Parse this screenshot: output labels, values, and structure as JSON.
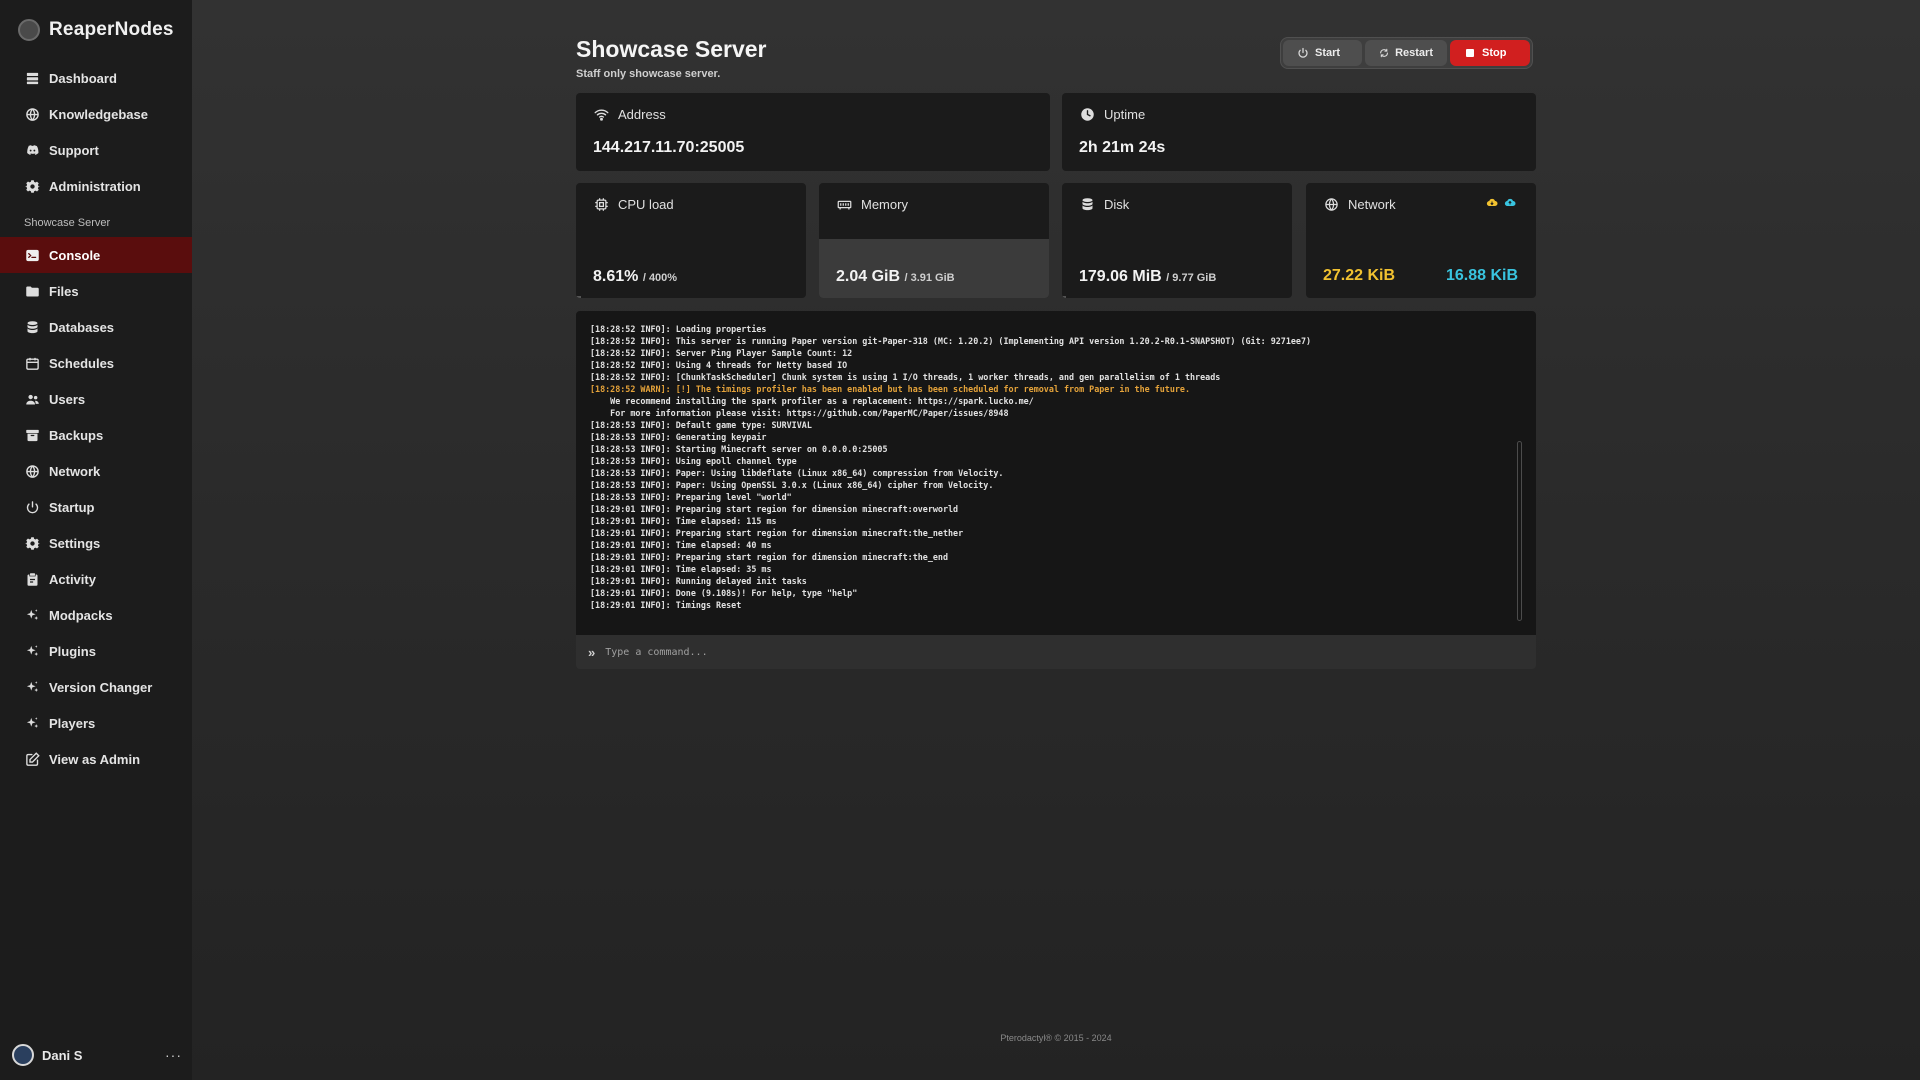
{
  "brand": {
    "name": "ReaperNodes"
  },
  "nav_main": [
    {
      "label": "Dashboard",
      "icon": "dashboard-icon"
    },
    {
      "label": "Knowledgebase",
      "icon": "globe-icon"
    },
    {
      "label": "Support",
      "icon": "discord-icon"
    },
    {
      "label": "Administration",
      "icon": "gear-icon"
    }
  ],
  "section_label": "Showcase Server",
  "nav_server": [
    {
      "label": "Console",
      "icon": "terminal-icon",
      "active": true
    },
    {
      "label": "Files",
      "icon": "folder-icon"
    },
    {
      "label": "Databases",
      "icon": "database-icon"
    },
    {
      "label": "Schedules",
      "icon": "calendar-icon"
    },
    {
      "label": "Users",
      "icon": "users-icon"
    },
    {
      "label": "Backups",
      "icon": "archive-icon"
    },
    {
      "label": "Network",
      "icon": "globe-icon"
    },
    {
      "label": "Startup",
      "icon": "power-icon"
    },
    {
      "label": "Settings",
      "icon": "gear-icon"
    },
    {
      "label": "Activity",
      "icon": "clipboard-icon"
    },
    {
      "label": "Modpacks",
      "icon": "sparkle-icon"
    },
    {
      "label": "Plugins",
      "icon": "sparkle-icon"
    },
    {
      "label": "Version Changer",
      "icon": "sparkle-icon"
    },
    {
      "label": "Players",
      "icon": "sparkle-icon"
    },
    {
      "label": "View as Admin",
      "icon": "external-edit-icon"
    }
  ],
  "user": {
    "name": "Dani S",
    "more": "···"
  },
  "server": {
    "title": "Showcase Server",
    "subtitle": "Staff only showcase server."
  },
  "power": {
    "start": "Start",
    "restart": "Restart",
    "stop": "Stop"
  },
  "stats": {
    "address": {
      "label": "Address",
      "value": "144.217.11.70:25005"
    },
    "uptime": {
      "label": "Uptime",
      "value": "2h 21m 24s"
    },
    "cpu": {
      "label": "CPU load",
      "value": "8.61%",
      "limit": "/ 400%",
      "usage_fraction": 0.0215
    },
    "memory": {
      "label": "Memory",
      "value": "2.04 GiB",
      "limit": "/ 3.91 GiB",
      "usage_fraction": 0.52
    },
    "disk": {
      "label": "Disk",
      "value": "179.06 MiB",
      "limit": "/ 9.77 GiB",
      "usage_fraction": 0.018
    },
    "network": {
      "label": "Network",
      "inbound": "27.22 KiB",
      "outbound": "16.88 KiB"
    }
  },
  "colors": {
    "accent_active": "#5a0d0d",
    "stop": "#d11f1f",
    "inbound": "#f2c230",
    "outbound": "#39c4df",
    "warn": "#e5a33a"
  },
  "console_lines": [
    {
      "text": "[18:28:52 INFO]: Loading properties",
      "warn": false
    },
    {
      "text": "[18:28:52 INFO]: This server is running Paper version git-Paper-318 (MC: 1.20.2) (Implementing API version 1.20.2-R0.1-SNAPSHOT) (Git: 9271ee7)",
      "warn": false
    },
    {
      "text": "[18:28:52 INFO]: Server Ping Player Sample Count: 12",
      "warn": false
    },
    {
      "text": "[18:28:52 INFO]: Using 4 threads for Netty based IO",
      "warn": false
    },
    {
      "text": "[18:28:52 INFO]: [ChunkTaskScheduler] Chunk system is using 1 I/O threads, 1 worker threads, and gen parallelism of 1 threads",
      "warn": false
    },
    {
      "text": "[18:28:52 WARN]: [!] The timings profiler has been enabled but has been scheduled for removal from Paper in the future.",
      "warn": true
    },
    {
      "text": "    We recommend installing the spark profiler as a replacement: https://spark.lucko.me/",
      "warn": false
    },
    {
      "text": "    For more information please visit: https://github.com/PaperMC/Paper/issues/8948",
      "warn": false
    },
    {
      "text": "[18:28:53 INFO]: Default game type: SURVIVAL",
      "warn": false
    },
    {
      "text": "[18:28:53 INFO]: Generating keypair",
      "warn": false
    },
    {
      "text": "[18:28:53 INFO]: Starting Minecraft server on 0.0.0.0:25005",
      "warn": false
    },
    {
      "text": "[18:28:53 INFO]: Using epoll channel type",
      "warn": false
    },
    {
      "text": "[18:28:53 INFO]: Paper: Using libdeflate (Linux x86_64) compression from Velocity.",
      "warn": false
    },
    {
      "text": "[18:28:53 INFO]: Paper: Using OpenSSL 3.0.x (Linux x86_64) cipher from Velocity.",
      "warn": false
    },
    {
      "text": "[18:28:53 INFO]: Preparing level \"world\"",
      "warn": false
    },
    {
      "text": "[18:29:01 INFO]: Preparing start region for dimension minecraft:overworld",
      "warn": false
    },
    {
      "text": "[18:29:01 INFO]: Time elapsed: 115 ms",
      "warn": false
    },
    {
      "text": "[18:29:01 INFO]: Preparing start region for dimension minecraft:the_nether",
      "warn": false
    },
    {
      "text": "[18:29:01 INFO]: Time elapsed: 40 ms",
      "warn": false
    },
    {
      "text": "[18:29:01 INFO]: Preparing start region for dimension minecraft:the_end",
      "warn": false
    },
    {
      "text": "[18:29:01 INFO]: Time elapsed: 35 ms",
      "warn": false
    },
    {
      "text": "[18:29:01 INFO]: Running delayed init tasks",
      "warn": false
    },
    {
      "text": "[18:29:01 INFO]: Done (9.108s)! For help, type \"help\"",
      "warn": false
    },
    {
      "text": "[18:29:01 INFO]: Timings Reset",
      "warn": false
    }
  ],
  "command": {
    "placeholder": "Type a command...",
    "value": ""
  },
  "footer": "Pterodactyl® © 2015 - 2024"
}
